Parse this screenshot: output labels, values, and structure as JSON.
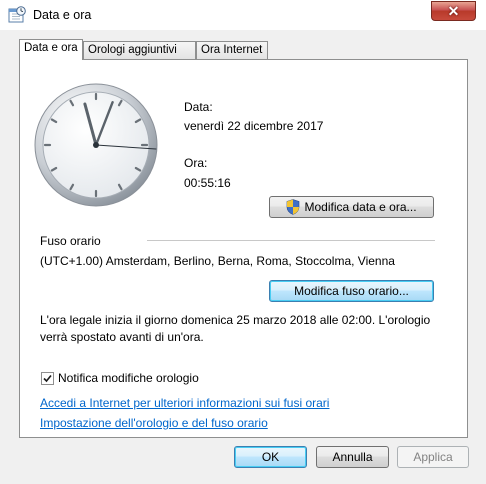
{
  "window": {
    "title": "Data e ora",
    "close_symbol": "✕"
  },
  "tabs": [
    {
      "label": "Data e ora",
      "active": true
    },
    {
      "label": "Orologi aggiuntivi",
      "active": false
    },
    {
      "label": "Ora Internet",
      "active": false
    }
  ],
  "datetime": {
    "date_label": "Data:",
    "date_value": "venerdì 22 dicembre 2017",
    "time_label": "Ora:",
    "time_value": "00:55:16",
    "change_button": "Modifica data e ora..."
  },
  "timezone": {
    "section_label": "Fuso orario",
    "value": "(UTC+1.00) Amsterdam, Berlino, Berna, Roma, Stoccolma, Vienna",
    "change_button": "Modifica fuso orario..."
  },
  "dst_info": {
    "line1": "L'ora legale inizia il giorno domenica 25 marzo 2018 alle 02:00. L'orologio",
    "line2": "verrà spostato avanti di un'ora."
  },
  "notify": {
    "label": "Notifica modifiche orologio",
    "checked": true
  },
  "links": {
    "internet_info": "Accedi a Internet per ulteriori informazioni sui fusi orari",
    "settings": "Impostazione dell'orologio e del fuso orario"
  },
  "footer": {
    "ok": "OK",
    "cancel": "Annulla",
    "apply": "Applica"
  },
  "icons": {
    "window_icon": "date-time-icon",
    "shield": "uac-shield-icon",
    "clock": "analog-clock-icon"
  },
  "colors": {
    "link": "#0066cc",
    "close_button": "#c75050",
    "focus_border": "#3c7fb1"
  }
}
